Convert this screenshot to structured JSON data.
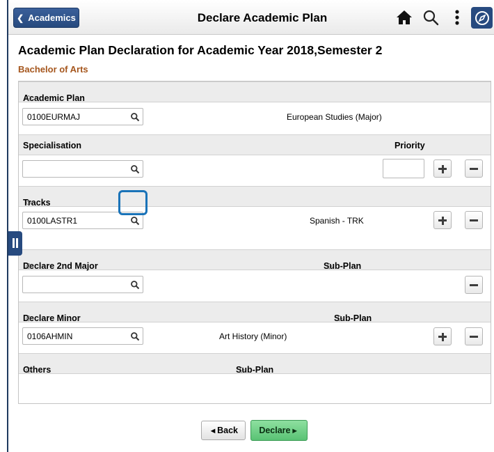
{
  "header": {
    "back_label": "Academics",
    "title": "Declare Academic Plan",
    "icons": [
      "home-icon",
      "search-icon",
      "more-icon",
      "navbar-compass-icon"
    ]
  },
  "page": {
    "title": "Academic Plan Declaration for Academic Year 2018,Semester 2",
    "program": "Bachelor of Arts"
  },
  "sections": {
    "academic_plan": {
      "header": "Academic Plan",
      "sort_icon": "◇",
      "value": "0100EURMAJ",
      "description": "European Studies (Major)"
    },
    "specialisation": {
      "header": "Specialisation",
      "priority_header": "Priority",
      "value": "",
      "priority_value": ""
    },
    "tracks": {
      "header": "Tracks",
      "value": "0100LASTR1",
      "description": "Spanish - TRK"
    },
    "second_major": {
      "header": "Declare 2nd Major",
      "subplan_header": "Sub-Plan",
      "value": ""
    },
    "minor": {
      "header": "Declare Minor",
      "subplan_header": "Sub-Plan",
      "value": "0106AHMIN",
      "description": "Art History (Minor)"
    },
    "others": {
      "header": "Others",
      "subplan_header": "Sub-Plan"
    }
  },
  "footer": {
    "back_label": "Back",
    "declare_label": "Declare"
  },
  "colors": {
    "brand_blue": "#274a7f",
    "program_orange": "#a5561d",
    "declare_green": "#59c274",
    "highlight_blue": "#1a73b8"
  }
}
